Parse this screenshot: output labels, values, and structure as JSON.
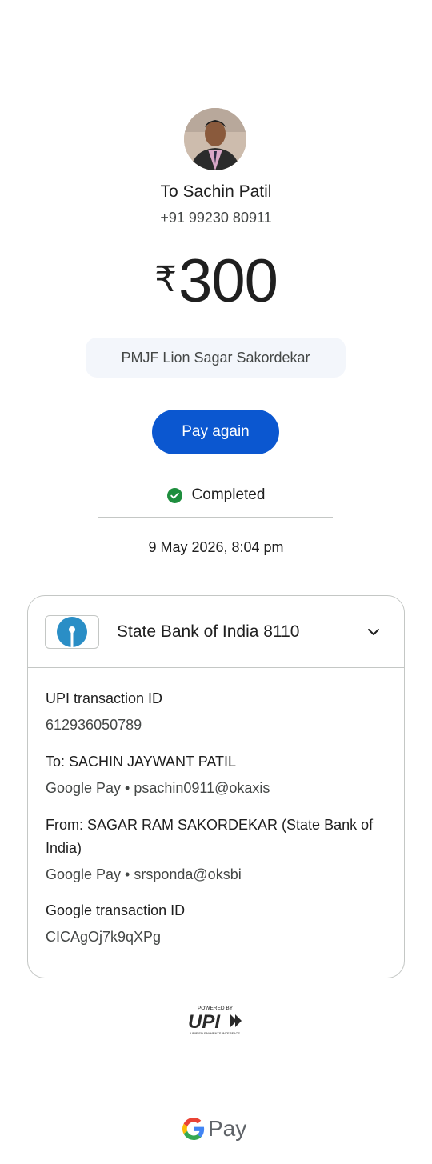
{
  "recipient": {
    "to_label": "To Sachin Patil",
    "phone": "+91 99230 80911"
  },
  "amount": {
    "currency_symbol": "₹",
    "value": "300"
  },
  "note": "PMJF Lion Sagar Sakordekar",
  "actions": {
    "pay_again_label": "Pay again"
  },
  "status": {
    "label": "Completed",
    "color": "#1e8e3e"
  },
  "datetime": "9 May 2026, 8:04 pm",
  "bank": {
    "name": "State Bank of India 8110",
    "logo_icon": "sbi-logo-icon",
    "accent": "#2a8ec6"
  },
  "details": {
    "upi_id_label": "UPI transaction ID",
    "upi_id_value": "612936050789",
    "to_label": "To: SACHIN JAYWANT PATIL",
    "to_value": "Google Pay • psachin0911@okaxis",
    "from_label": "From: SAGAR RAM  SAKORDEKAR (State Bank of India)",
    "from_value": "Google Pay • srsponda@oksbi",
    "google_id_label": "Google transaction ID",
    "google_id_value": "CICAgOj7k9qXPg"
  },
  "footer": {
    "upi_powered_by": "POWERED BY",
    "upi_wordmark": "UPI",
    "upi_tagline": "UNIFIED PAYMENTS INTERFACE",
    "gpay_label": "Pay"
  },
  "colors": {
    "primary_button": "#0b57d0",
    "note_bg": "#f3f6fb"
  }
}
